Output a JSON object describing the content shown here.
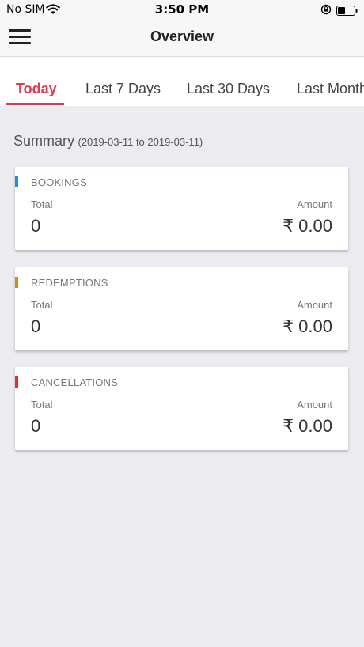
{
  "status_bar": {
    "carrier": "No SIM",
    "time": "3:50 PM",
    "wifi_icon": "wifi-icon",
    "orientation_lock_icon": "rotation-lock-icon",
    "battery_icon": "battery-icon"
  },
  "header": {
    "title": "Overview",
    "menu_icon": "hamburger-menu-icon"
  },
  "tabs": [
    {
      "label": "Today",
      "active": true
    },
    {
      "label": "Last 7 Days",
      "active": false
    },
    {
      "label": "Last 30 Days",
      "active": false
    },
    {
      "label": "Last Month",
      "active": false
    }
  ],
  "summary": {
    "title": "Summary",
    "range": "(2019-03-11 to 2019-03-11)"
  },
  "cards": [
    {
      "title": "BOOKINGS",
      "total_label": "Total",
      "amount_label": "Amount",
      "total": "0",
      "amount": "₹ 0.00",
      "color": "#1e8be8"
    },
    {
      "title": "REDEMPTIONS",
      "total_label": "Total",
      "amount_label": "Amount",
      "total": "0",
      "amount": "₹ 0.00",
      "color": "#d4891c"
    },
    {
      "title": "CANCELLATIONS",
      "total_label": "Total",
      "amount_label": "Amount",
      "total": "0",
      "amount": "₹ 0.00",
      "color": "#e52a36"
    }
  ],
  "colors": {
    "accent": "#e5384c",
    "background": "#ebebf0"
  }
}
